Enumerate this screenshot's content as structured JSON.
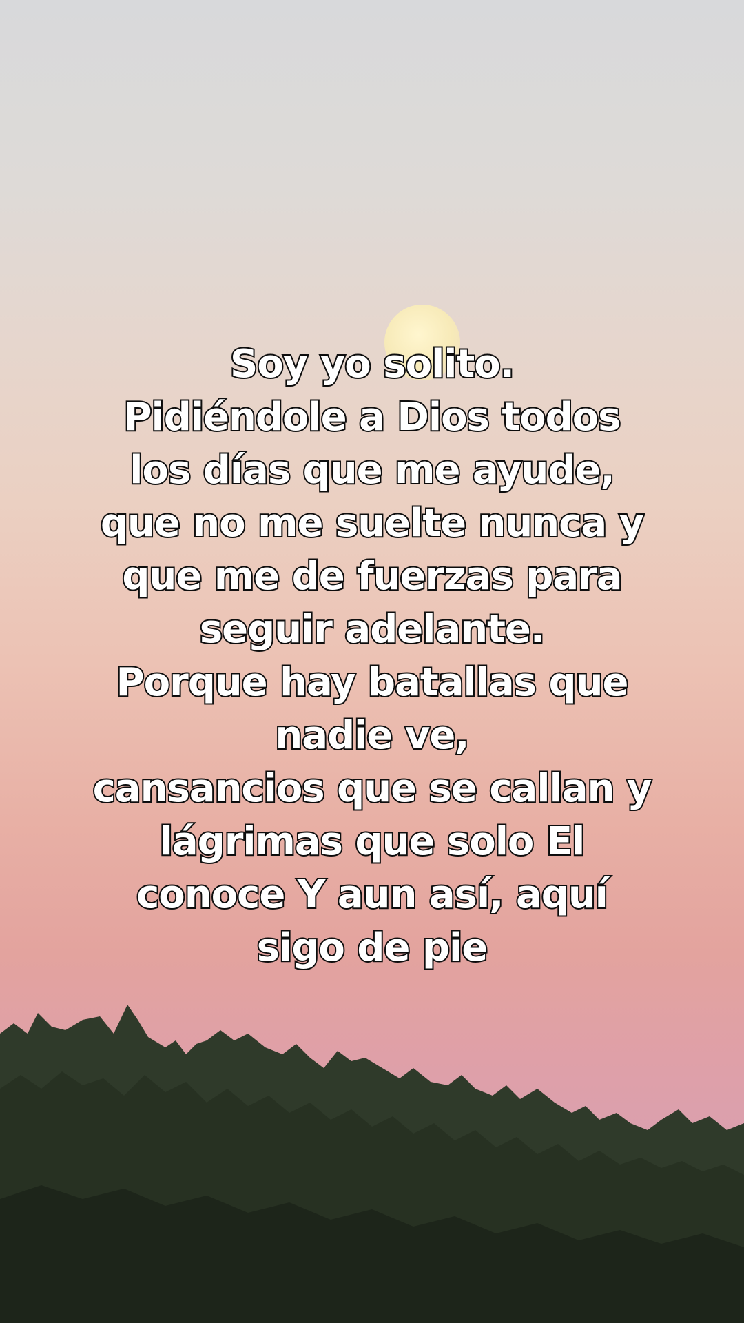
{
  "quote": {
    "lines": [
      "Soy yo solito.",
      "Pidiéndole a Dios todos",
      "los días que me ayude,",
      "que no me suelte nunca y",
      "que me de fuerzas para",
      "seguir adelante.",
      "Porque hay batallas que",
      "nadie ve,",
      "cansancios que se callan y",
      "lágrimas que solo El",
      "conoce Y aun así, aquí",
      "sigo de pie"
    ]
  },
  "scene": {
    "sky_top_color": "#d8d9db",
    "sky_bottom_color": "#d99fb0",
    "moon_color": "#f7eab8",
    "foliage_color": "#2f3a2a"
  }
}
